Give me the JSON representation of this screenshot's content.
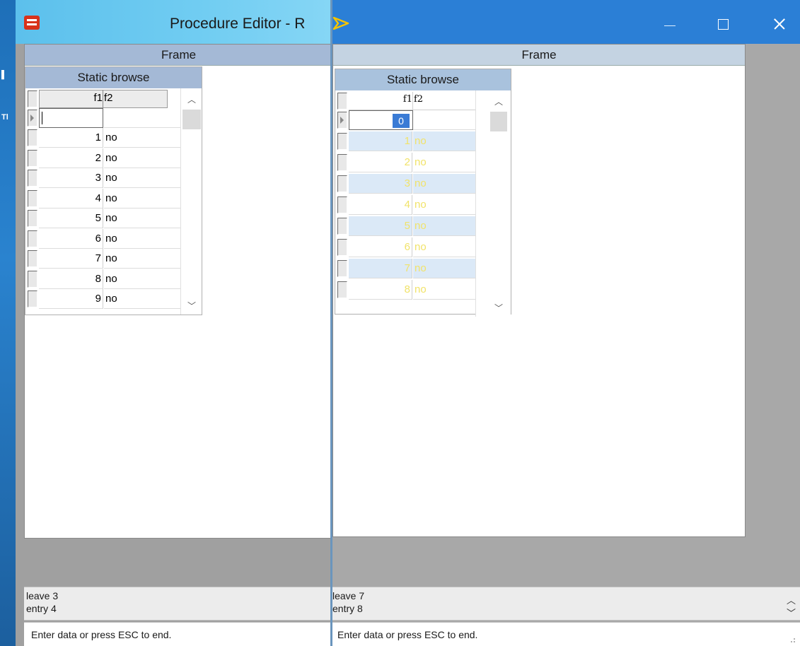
{
  "left_window": {
    "title": "Procedure Editor - R",
    "frame_title": "Frame",
    "browse_title": "Static browse",
    "columns": [
      "f1",
      "f2"
    ],
    "rows": [
      {
        "f1": "1",
        "f2": "no"
      },
      {
        "f1": "2",
        "f2": "no"
      },
      {
        "f1": "3",
        "f2": "no"
      },
      {
        "f1": "4",
        "f2": "no"
      },
      {
        "f1": "5",
        "f2": "no"
      },
      {
        "f1": "6",
        "f2": "no"
      },
      {
        "f1": "7",
        "f2": "no"
      },
      {
        "f1": "8",
        "f2": "no"
      },
      {
        "f1": "9",
        "f2": "no"
      }
    ],
    "messages": [
      "leave 3",
      "entry 4"
    ],
    "status": "Enter data or press ESC to end."
  },
  "right_window": {
    "frame_title": "Frame",
    "browse_title": "Static browse",
    "columns": [
      "f1",
      "f2"
    ],
    "edit_value": "0",
    "rows": [
      {
        "f1": "1",
        "f2": "no"
      },
      {
        "f1": "2",
        "f2": "no"
      },
      {
        "f1": "3",
        "f2": "no"
      },
      {
        "f1": "4",
        "f2": "no"
      },
      {
        "f1": "5",
        "f2": "no"
      },
      {
        "f1": "6",
        "f2": "no"
      },
      {
        "f1": "7",
        "f2": "no"
      },
      {
        "f1": "8",
        "f2": "no"
      }
    ],
    "messages": [
      "leave 7",
      "entry 8"
    ],
    "status": "Enter data or press ESC to end."
  },
  "icons": {
    "app": "app-icon",
    "minimize": "minimize-icon",
    "maximize": "maximize-icon",
    "close": "close-icon",
    "scroll_up": "chevron-up-icon",
    "scroll_down": "chevron-down-icon"
  },
  "colors": {
    "left_titlebar": "#71cdf2",
    "right_titlebar": "#2b7fd6",
    "frame_header_left": "#a4b9d6",
    "frame_header_right": "#c4d3e2",
    "alt_row": "#dbe9f7",
    "dim_text": "#f1e36a",
    "selection": "#3a7bd5"
  }
}
